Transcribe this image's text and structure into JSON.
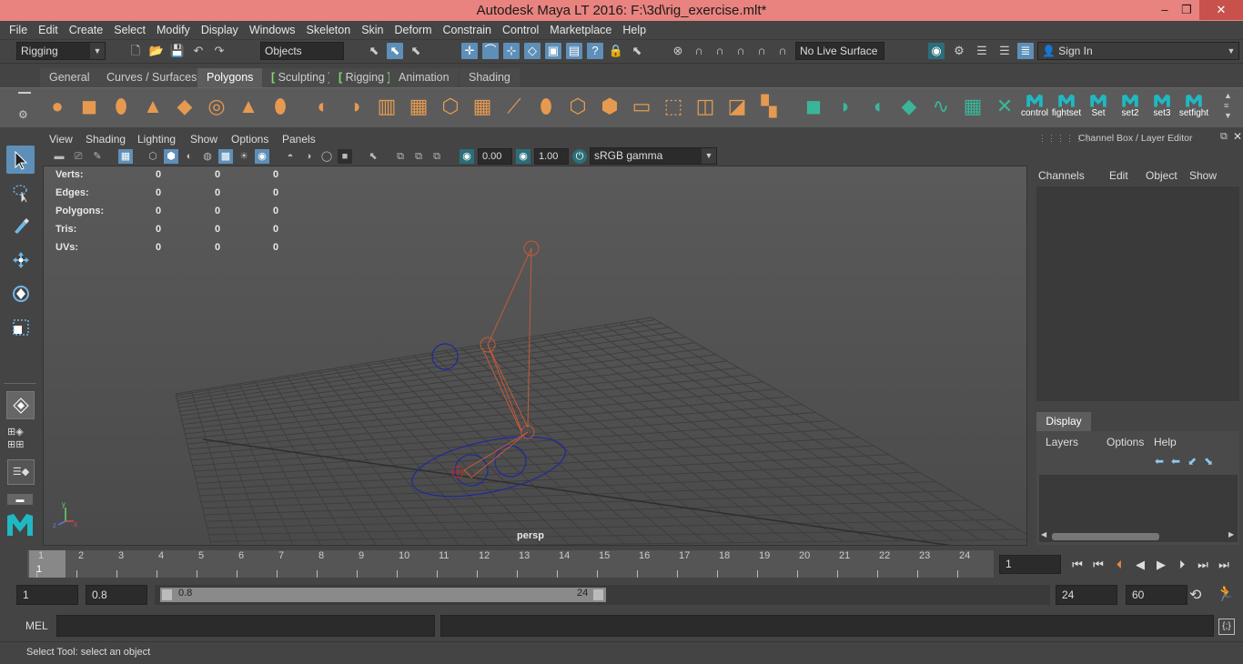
{
  "window": {
    "title": "Autodesk Maya LT 2016: F:\\3d\\rig_exercise.mlt*",
    "minimize": "–",
    "maximize": "❐",
    "close": "✕"
  },
  "menubar": [
    "File",
    "Edit",
    "Create",
    "Select",
    "Modify",
    "Display",
    "Windows",
    "Skeleton",
    "Skin",
    "Deform",
    "Constrain",
    "Control",
    "Marketplace",
    "Help"
  ],
  "statusline": {
    "menuset": "Rigging",
    "selection_mode": "Objects",
    "live_surface": "No Live Surface",
    "sign_in": "Sign In"
  },
  "shelf_tabs": [
    {
      "label": "General",
      "active": false
    },
    {
      "label": "Curves / Surfaces",
      "active": false
    },
    {
      "label": "Polygons",
      "active": true
    },
    {
      "label": "Sculpting",
      "active": false,
      "bracket": true
    },
    {
      "label": "Rigging",
      "active": false,
      "bracket": true
    },
    {
      "label": "Animation",
      "active": false
    },
    {
      "label": "Shading",
      "active": false
    }
  ],
  "shelf_custom_labels": [
    "control",
    "fightset",
    "Set",
    "set2",
    "set3",
    "setfight"
  ],
  "viewport": {
    "menus": [
      "View",
      "Shading",
      "Lighting",
      "Show",
      "Options",
      "Panels"
    ],
    "exposure": "0.00",
    "gamma": "1.00",
    "color_space": "sRGB gamma",
    "camera_label": "persp",
    "hud": [
      {
        "label": "Verts:",
        "v1": "0",
        "v2": "0",
        "v3": "0"
      },
      {
        "label": "Edges:",
        "v1": "0",
        "v2": "0",
        "v3": "0"
      },
      {
        "label": "Polygons:",
        "v1": "0",
        "v2": "0",
        "v3": "0"
      },
      {
        "label": "Tris:",
        "v1": "0",
        "v2": "0",
        "v3": "0"
      },
      {
        "label": "UVs:",
        "v1": "0",
        "v2": "0",
        "v3": "0"
      }
    ]
  },
  "right_panel": {
    "header": "Channel Box / Layer Editor",
    "channel_menus": [
      "Channels",
      "Edit",
      "Object",
      "Show"
    ],
    "display_tab": "Display",
    "layer_menus": [
      "Layers",
      "Options",
      "Help"
    ]
  },
  "timeline": {
    "ticks": [
      "1",
      "2",
      "3",
      "4",
      "5",
      "6",
      "7",
      "8",
      "9",
      "10",
      "11",
      "12",
      "13",
      "14",
      "15",
      "16",
      "17",
      "18",
      "19",
      "20",
      "21",
      "22",
      "23",
      "24"
    ],
    "current_frame_label": "1",
    "current_frame": "1"
  },
  "range": {
    "start": "1",
    "anim_start": "0.8",
    "slider_start": "0.8",
    "slider_end": "24",
    "end": "24",
    "anim_end": "60"
  },
  "command": {
    "lang": "MEL"
  },
  "help_line": "Select Tool: select an object",
  "colors": {
    "title_bar": "#e8837f",
    "active_blue": "#5e8fb8",
    "shelf_orange": "#e69a50",
    "bracket_green": "#7bdc6a",
    "joint_red": "#c55a3a",
    "control_blue": "#1f2a9b"
  }
}
